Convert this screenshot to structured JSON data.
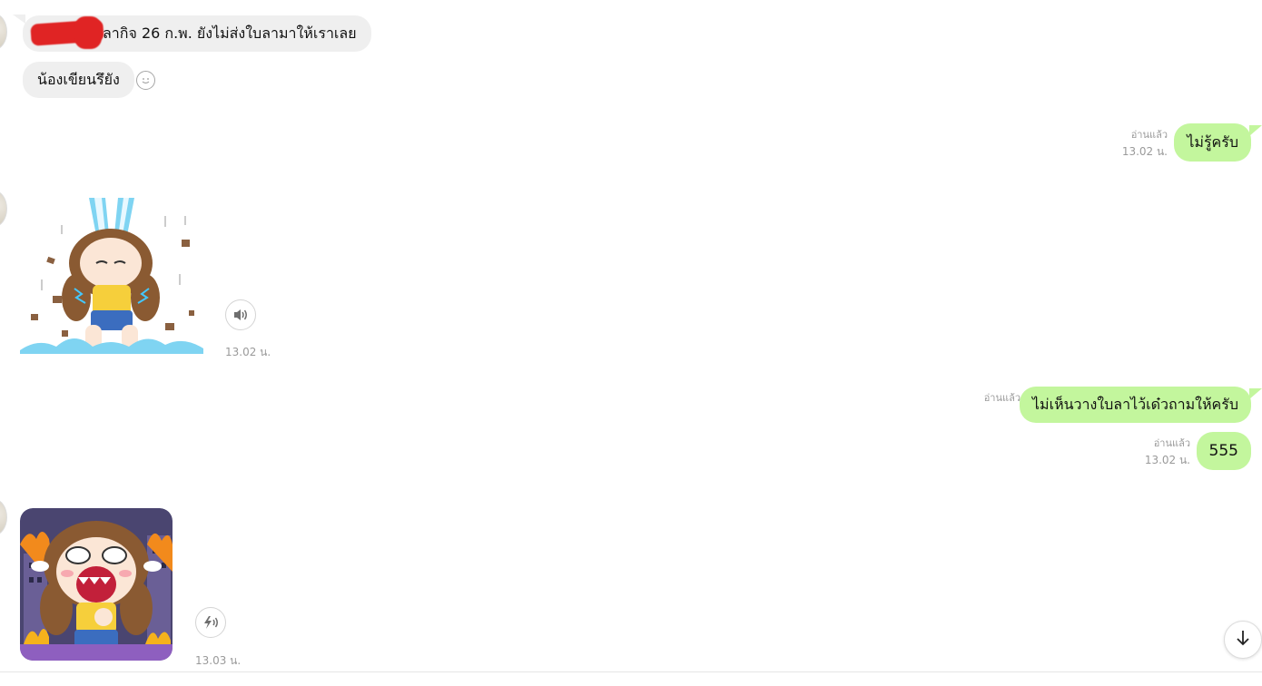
{
  "messages": {
    "m1": {
      "text": "ลากิจ 26 ก.พ. ยังไม่ส่งใบลามาให้เราเลย"
    },
    "m2": {
      "text": "น้องเขียนรึยัง"
    },
    "m3": {
      "text": "ไม่รู้ครับ",
      "read": "อ่านแล้ว",
      "time": "13.02 น."
    },
    "m4": {
      "time": "13.02 น."
    },
    "m5": {
      "text": "ไม่เห็นวางใบลาไว้เด๋วถามให้ครับ",
      "read": "อ่านแล้ว"
    },
    "m6": {
      "text": "555",
      "read": "อ่านแล้ว",
      "time": "13.02 น."
    },
    "m7": {
      "time": "13.03 น."
    }
  },
  "icons": {
    "reaction": "smiley-icon",
    "sound": "speaker-icon",
    "sound_effect": "sound-effect-icon",
    "scroll": "arrow-down-icon"
  },
  "colors": {
    "incoming_bubble": "#efefef",
    "outgoing_bubble": "#c3f69d",
    "meta_text": "#9a9a9a"
  }
}
